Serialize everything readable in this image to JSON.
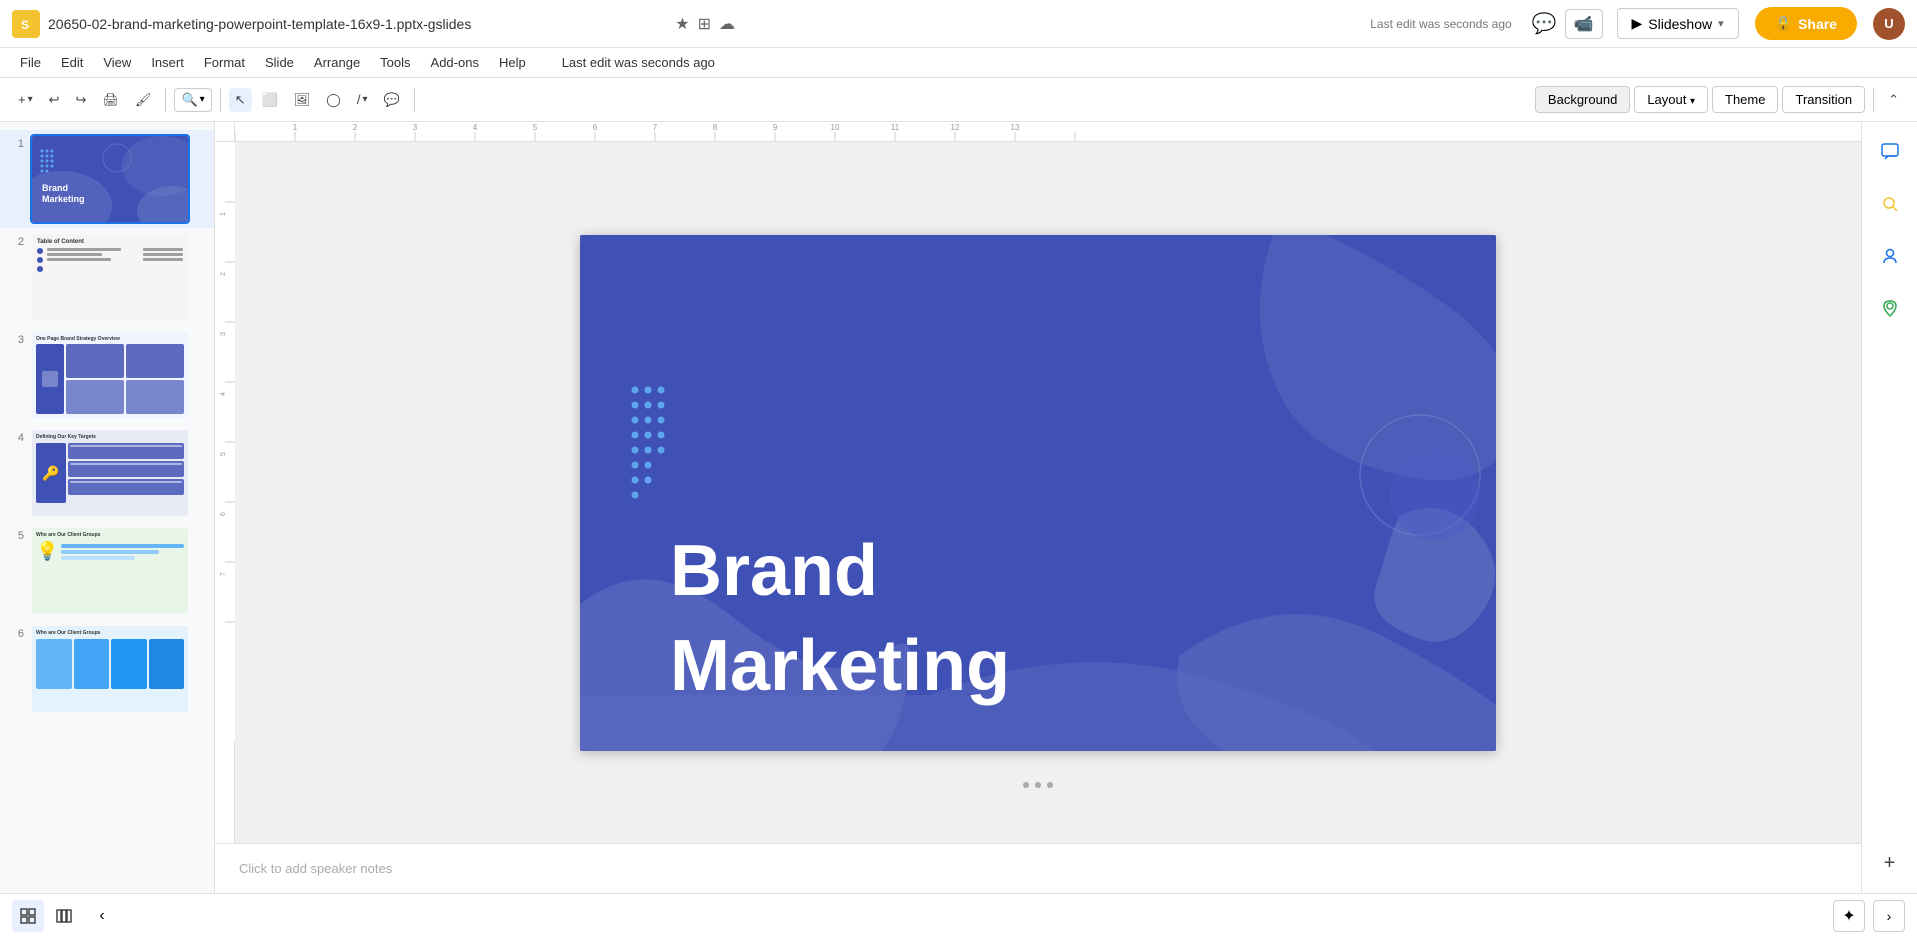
{
  "app": {
    "logo_char": "S",
    "logo_bg": "#f4c430"
  },
  "title_bar": {
    "filename": "20650-02-brand-marketing-powerpoint-template-16x9-1.pptx-gslides",
    "last_edit": "Last edit was seconds ago",
    "star_icon": "★",
    "folder_icon": "⊞",
    "cloud_icon": "☁",
    "comment_icon": "💬",
    "slideshow_label": "Slideshow",
    "share_label": "Share",
    "share_icon": "🔒"
  },
  "menu": {
    "items": [
      "File",
      "Edit",
      "View",
      "Insert",
      "Format",
      "Slide",
      "Arrange",
      "Tools",
      "Add-ons",
      "Help"
    ]
  },
  "toolbar": {
    "background_label": "Background",
    "layout_label": "Layout",
    "theme_label": "Theme",
    "transition_label": "Transition"
  },
  "slides": [
    {
      "num": "1",
      "active": true,
      "type": "title",
      "title": "Brand\nMarketing"
    },
    {
      "num": "2",
      "active": false,
      "type": "toc",
      "title": "Table of Content"
    },
    {
      "num": "3",
      "active": false,
      "type": "strategy",
      "title": "One Page Brand Strategy Overview"
    },
    {
      "num": "4",
      "active": false,
      "type": "targets",
      "title": "Defining Our Key Targets"
    },
    {
      "num": "5",
      "active": false,
      "type": "clients",
      "title": "Who are Our Client Groups"
    },
    {
      "num": "6",
      "active": false,
      "type": "clients2",
      "title": "Who are Our Client Groups"
    }
  ],
  "slide_main": {
    "title_line1": "Brand",
    "title_line2": "Marketing",
    "bg_color": "#3f51b5"
  },
  "notes": {
    "placeholder": "Click to add speaker notes"
  },
  "bottom_bar": {
    "collapse_icon": "‹"
  },
  "right_sidebar": {
    "icons": [
      "chat",
      "search",
      "person",
      "map-pin"
    ]
  }
}
